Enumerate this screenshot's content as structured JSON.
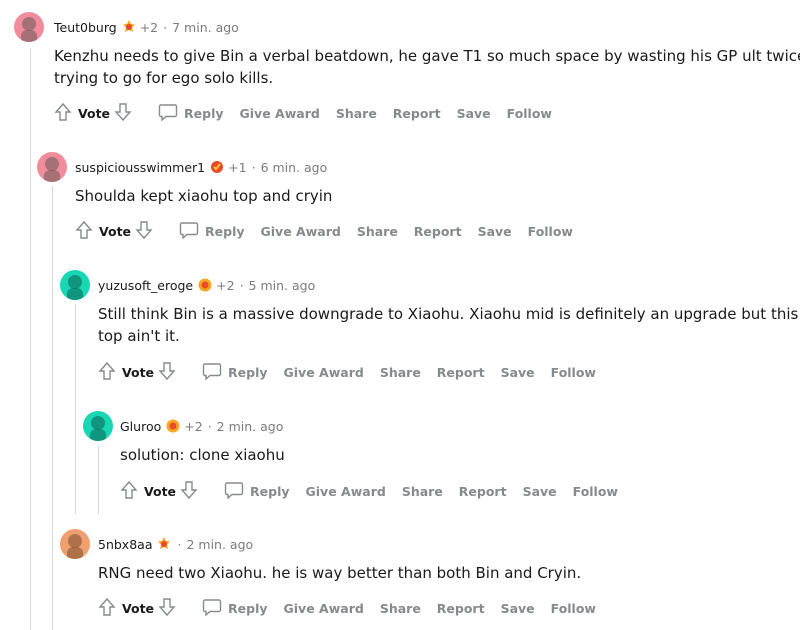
{
  "labels": {
    "vote": "Vote",
    "reply": "Reply",
    "give_award": "Give Award",
    "share": "Share",
    "report": "Report",
    "save": "Save",
    "follow": "Follow",
    "dot": "·"
  },
  "comments": [
    {
      "username": "Teut0burg",
      "award_count": "+2",
      "time": "7 min. ago",
      "text_lines": [
        "Kenzhu needs to give Bin a verbal beatdown, he gave T1 so much space by wasting his GP ult twice",
        "trying to go for ego solo kills."
      ],
      "avatar_color": "#f08c9c"
    },
    {
      "username": "suspiciousswimmer1",
      "award_count": "+1",
      "time": "6 min. ago",
      "text_lines": [
        "Shoulda kept xiaohu top and cryin"
      ],
      "avatar_color": "#f08c9c"
    },
    {
      "username": "yuzusoft_eroge",
      "award_count": "+2",
      "time": "5 min. ago",
      "text_lines": [
        "Still think Bin is a massive downgrade to Xiaohu. Xiaohu mid is definitely an upgrade but this",
        "top ain't it."
      ],
      "avatar_color": "#19d6b5"
    },
    {
      "username": "Gluroo",
      "award_count": "+2",
      "time": "2 min. ago",
      "text_lines": [
        "solution: clone xiaohu"
      ],
      "avatar_color": "#19d6b5"
    },
    {
      "username": "5nbx8aa",
      "award_count": "",
      "time": "2 min. ago",
      "text_lines": [
        "RNG need two Xiaohu. he is way better than both Bin and Cryin."
      ],
      "avatar_color": "#f0a070"
    }
  ]
}
